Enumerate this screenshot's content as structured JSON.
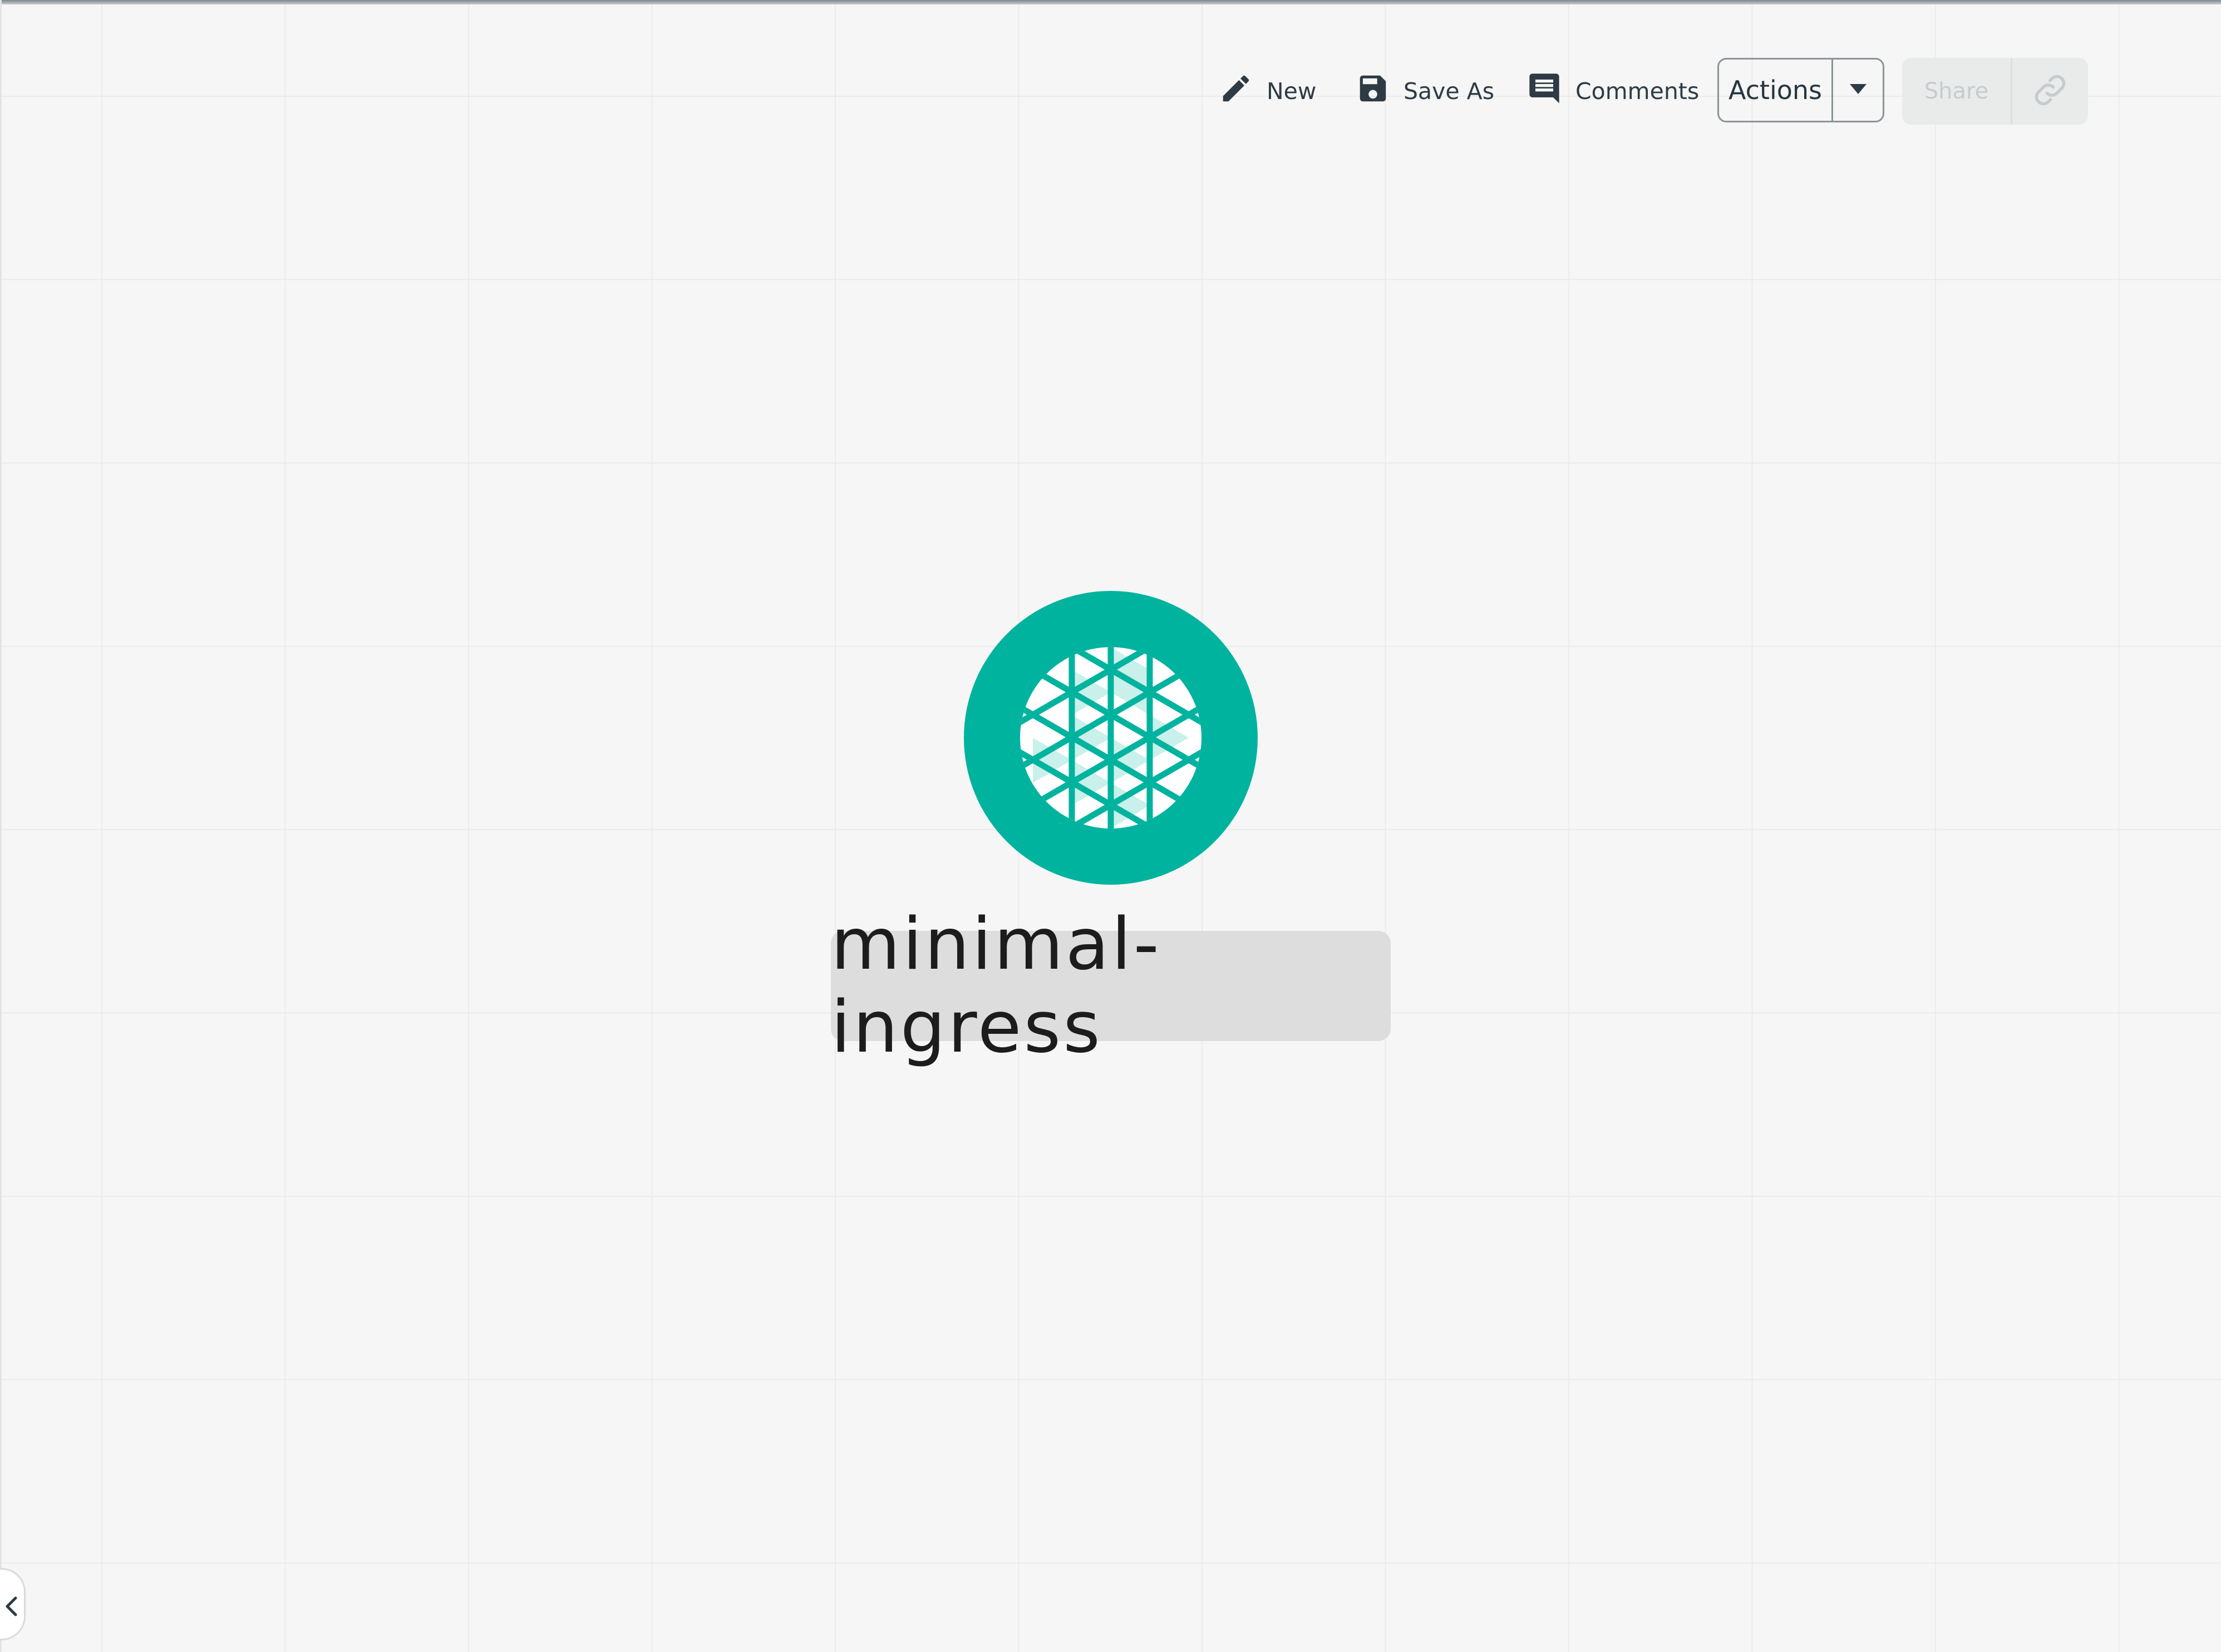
{
  "toolbar": {
    "new_label": "New",
    "save_as_label": "Save As",
    "comments_label": "Comments",
    "actions_label": "Actions",
    "share_label": "Share",
    "icons": {
      "new": "pencil-icon",
      "save_as": "floppy-disk-icon",
      "comments": "comment-icon",
      "actions_menu": "caret-down-icon",
      "share_link": "link-icon"
    }
  },
  "canvas": {
    "node": {
      "label": "minimal-ingress",
      "icon": "ingress-icon",
      "icon_color": "#00b39f"
    },
    "collapse_icon": "chevron-left-icon"
  },
  "colors": {
    "accent": "#00b39f",
    "accent_light": "#c9f0ea",
    "background": "#f5f6f5",
    "text": "#2e3b45"
  }
}
